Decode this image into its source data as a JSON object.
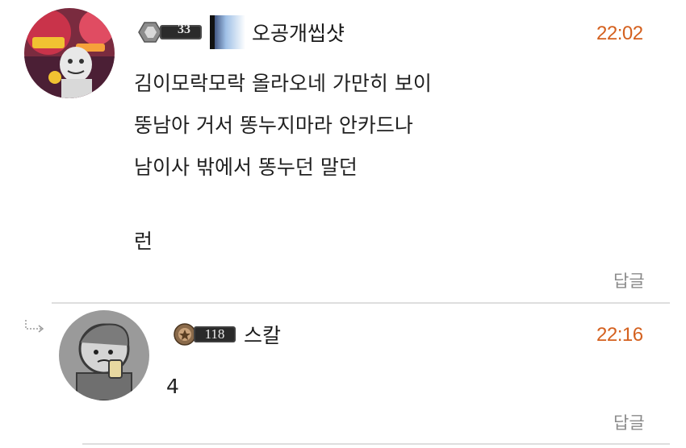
{
  "comments": [
    {
      "level": "33",
      "nickname": "오공개씹샷",
      "time": "22:02",
      "lines": [
        "김이모락모락 올라오네 가만히 보이",
        "뚱남아 거서 똥누지마라 안카드나",
        "남이사 밖에서 똥누던 말던",
        "",
        "런"
      ],
      "reply_label": "답글"
    }
  ],
  "replies": [
    {
      "level": "118",
      "nickname": "스칼",
      "time": "22:16",
      "lines": [
        "4"
      ],
      "reply_label": "답글"
    }
  ],
  "colors": {
    "timestamp": "#d4611f",
    "divider": "#dedede",
    "reply_link": "#8a8a8a"
  },
  "icons": {
    "level_badge_1": "hexagon-level-badge",
    "level_badge_2": "medal-level-badge",
    "reply_indent": "reply-arrow-icon"
  }
}
